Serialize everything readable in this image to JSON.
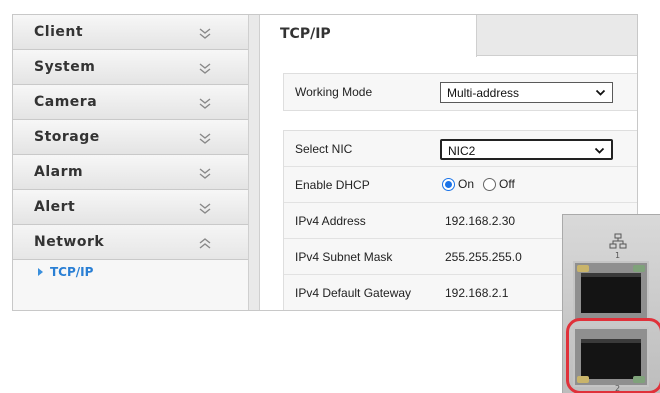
{
  "sidebar": {
    "items": [
      {
        "label": "Client",
        "state": "collapsed"
      },
      {
        "label": "System",
        "state": "collapsed"
      },
      {
        "label": "Camera",
        "state": "collapsed"
      },
      {
        "label": "Storage",
        "state": "collapsed"
      },
      {
        "label": "Alarm",
        "state": "collapsed"
      },
      {
        "label": "Alert",
        "state": "collapsed"
      },
      {
        "label": "Network",
        "state": "expanded"
      }
    ],
    "submenu": {
      "label": "TCP/IP",
      "active": true
    }
  },
  "tabs": [
    {
      "label": "TCP/IP",
      "active": true
    }
  ],
  "form": {
    "working_mode": {
      "label": "Working Mode",
      "value": "Multi-address"
    },
    "select_nic": {
      "label": "Select NIC",
      "value": "NIC2"
    },
    "dhcp": {
      "label": "Enable DHCP",
      "on_label": "On",
      "off_label": "Off",
      "selected": "On"
    },
    "ipv4_address": {
      "label": "IPv4 Address",
      "value": "192.168.2.30"
    },
    "subnet_mask": {
      "label": "IPv4 Subnet Mask",
      "value": "255.255.255.0"
    },
    "gateway": {
      "label": "IPv4 Default Gateway",
      "value": "192.168.2.1"
    }
  },
  "photo": {
    "port1_label": "1",
    "port2_label": "2",
    "highlighted_port": 2,
    "icons": [
      "network-icon"
    ],
    "highlight_color": "#e0313a"
  },
  "colors": {
    "accent": "#1a73e8",
    "submenu_text": "#2a7fd4"
  }
}
